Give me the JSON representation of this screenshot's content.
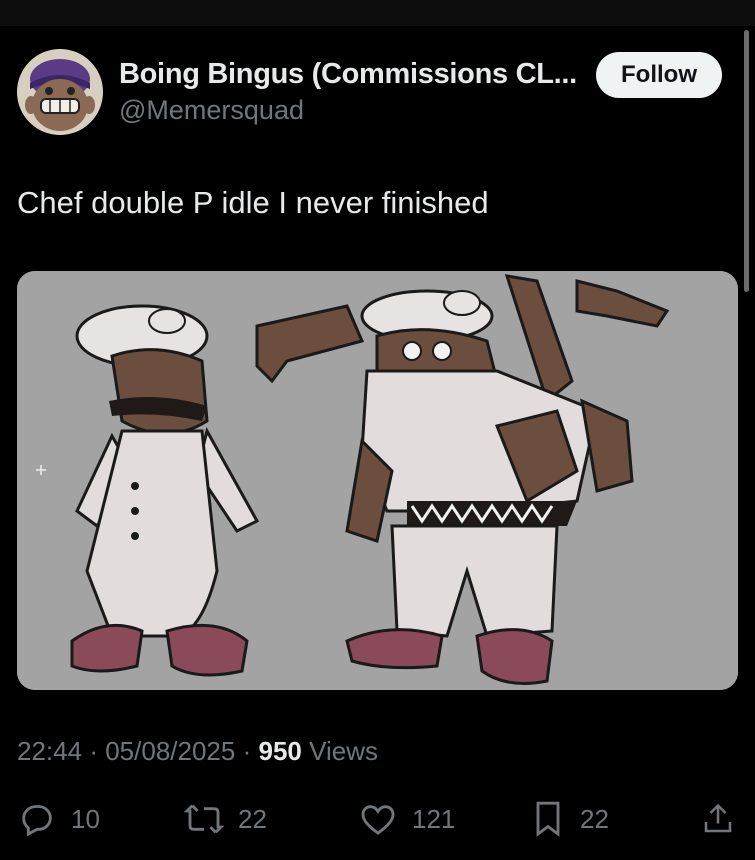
{
  "post": {
    "author_name": "Boing Bingus (Commissions CL...",
    "author_handle": "@Memersquad",
    "follow_label": "Follow",
    "text": "Chef double P idle I never finished",
    "timestamp_time": "22:44",
    "timestamp_date": "05/08/2025",
    "separator": "·",
    "views_count": "950",
    "views_label": "Views"
  },
  "actions": {
    "replies": "10",
    "reposts": "22",
    "likes": "121",
    "bookmarks": "22"
  },
  "colors": {
    "background": "#000000",
    "text_primary": "#e7e9ea",
    "text_secondary": "#71767b",
    "follow_bg": "#eff3f4",
    "media_bg": "#a3a3a3"
  },
  "icons": [
    "reply-icon",
    "repost-icon",
    "like-icon",
    "bookmark-icon",
    "share-icon"
  ]
}
